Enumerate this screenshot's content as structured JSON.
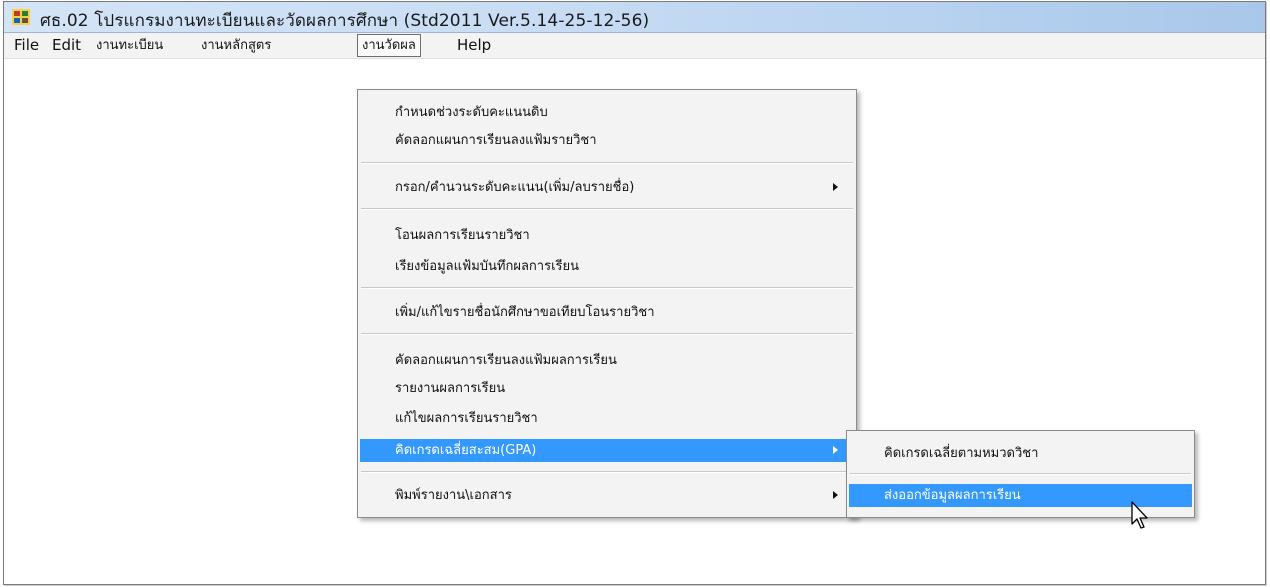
{
  "window": {
    "title": "ศธ.02 โปรแกรมงานทะเบียนและวัดผลการศึกษา (Std2011 Ver.5.14-25-12-56)"
  },
  "menubar": {
    "items": [
      "File",
      "Edit",
      "งานทะเบียน",
      "งานหลักสูตร",
      "งานวัดผล",
      "Help"
    ],
    "open_item": "งานวัดผล"
  },
  "menu_measure": {
    "items": [
      "กำหนดช่วงระดับคะแนนดิบ",
      "คัดลอกแผนการเรียนลงแฟ้มรายวิชา",
      "กรอก/คำนวนระดับคะแนน(เพิ่ม/ลบรายชื่อ)",
      "โอนผลการเรียนรายวิชา",
      "เรียงข้อมูลแฟ้มบันทึกผลการเรียน",
      "เพิ่ม/แก้ไขรายชื่อนักศึกษาขอเทียบโอนรายวิชา",
      "คัดลอกแผนการเรียนลงแฟ้มผลการเรียน",
      "รายงานผลการเรียน",
      "แก้ไขผลการเรียนรายวิชา",
      "คิดเกรดเฉลี่ยสะสม(GPA)",
      "พิมพ์รายงาน\\เอกสาร"
    ],
    "highlighted": "คิดเกรดเฉลี่ยสะสม(GPA)"
  },
  "submenu_gpa": {
    "items": [
      "คิดเกรดเฉลี่ยตามหมวดวิชา",
      "ส่งออกข้อมูลผลการเรียน"
    ],
    "highlighted": "ส่งออกข้อมูลผลการเรียน"
  },
  "colors": {
    "highlight": "#3399ff",
    "menu_bg": "#f3f3f3",
    "titlebar": "#c7dcf4"
  },
  "icons": {
    "app": "app-icon",
    "submenu": "submenu-arrow-icon",
    "pointer": "mouse-pointer-icon"
  }
}
